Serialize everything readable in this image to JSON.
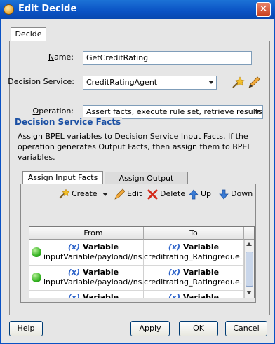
{
  "window": {
    "title": "Edit Decide",
    "close_symbol": "✕"
  },
  "tabs": {
    "main": "Decide"
  },
  "form": {
    "name_label": "Name:",
    "name_value": "GetCreditRating",
    "decision_service_label": "Decision Service:",
    "decision_service_value": "CreditRatingAgent",
    "operation_label": "Operation:",
    "operation_value": "Assert facts, execute rule set, retrieve results..."
  },
  "facts": {
    "section_title": "Decision Service Facts",
    "description": "Assign BPEL variables to Decision Service Input Facts. If the operation generates Output Facts, then assign them to BPEL variables.",
    "tabs": [
      "Assign Input Facts",
      "Assign Output Facts"
    ],
    "toolbar": {
      "create": "Create",
      "edit": "Edit",
      "delete": "Delete",
      "up": "Up",
      "down": "Down"
    },
    "columns": [
      "From",
      "To"
    ],
    "rows": [
      {
        "from_kind": "Variable",
        "from_path": "inputVariable/payload//ns...",
        "to_kind": "Variable",
        "to_path": "creditrating_Ratingreque..."
      },
      {
        "from_kind": "Variable",
        "from_path": "inputVariable/payload//ns...",
        "to_kind": "Variable",
        "to_path": "creditrating_Ratingreque..."
      },
      {
        "from_kind": "Variable",
        "from_path": "",
        "to_kind": "Variable",
        "to_path": ""
      }
    ],
    "variable_prefix": "(x)"
  },
  "buttons": {
    "help": "Help",
    "apply": "Apply",
    "ok": "OK",
    "cancel": "Cancel"
  },
  "colors": {
    "titlebar": "#0a52c4",
    "section_title": "#1a4fa3",
    "status_dot": "#35b322"
  }
}
